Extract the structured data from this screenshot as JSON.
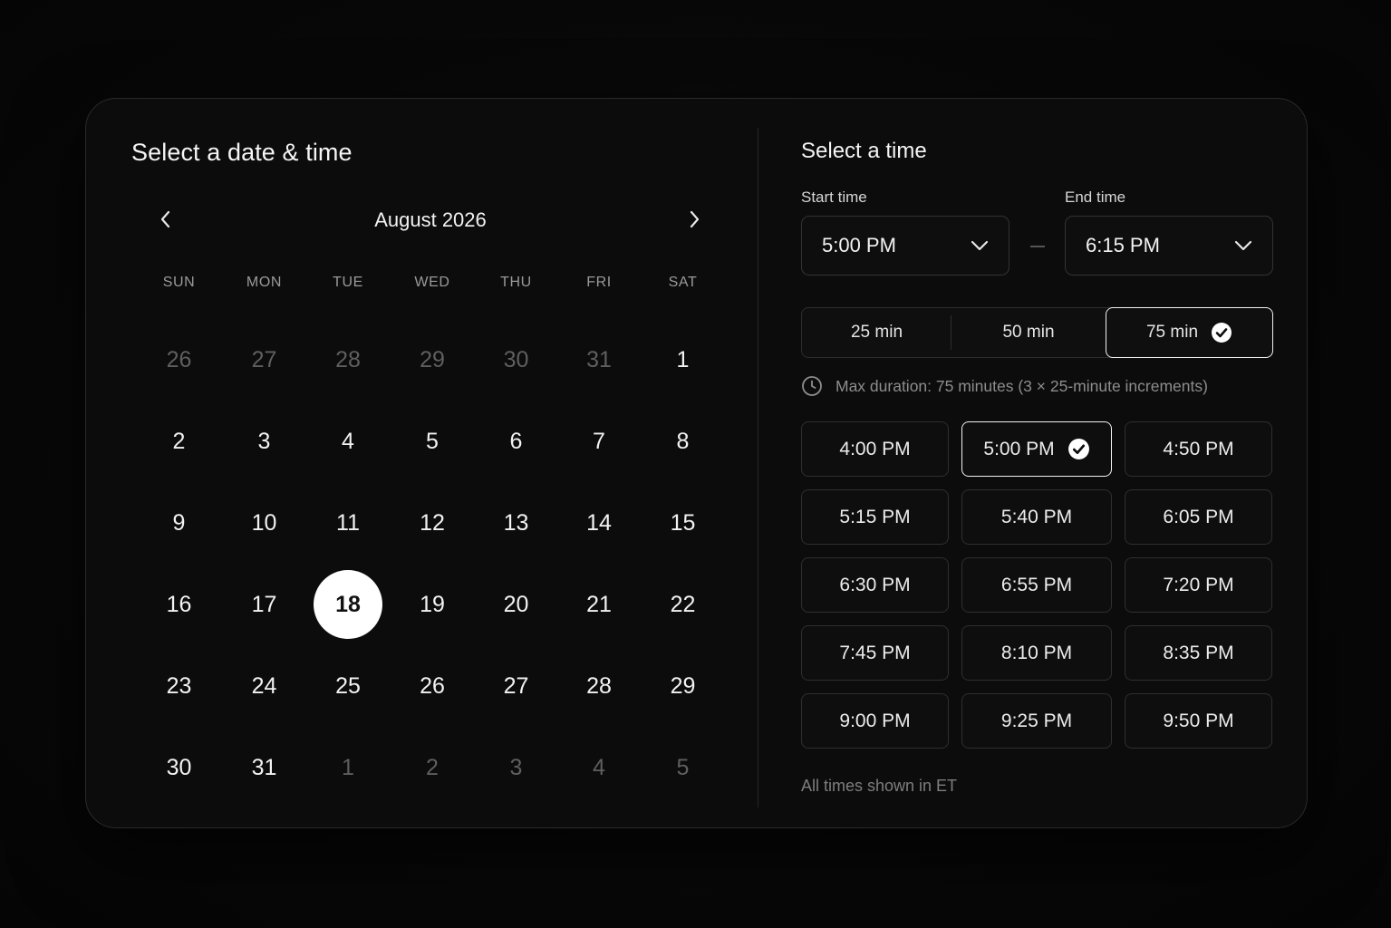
{
  "left": {
    "title": "Select a date & time",
    "month_label": "August 2026",
    "weekdays": [
      "SUN",
      "MON",
      "TUE",
      "WED",
      "THU",
      "FRI",
      "SAT"
    ],
    "days": [
      {
        "label": "26",
        "muted": true
      },
      {
        "label": "27",
        "muted": true
      },
      {
        "label": "28",
        "muted": true
      },
      {
        "label": "29",
        "muted": true
      },
      {
        "label": "30",
        "muted": true
      },
      {
        "label": "31",
        "muted": true
      },
      {
        "label": "1"
      },
      {
        "label": "2"
      },
      {
        "label": "3"
      },
      {
        "label": "4"
      },
      {
        "label": "5"
      },
      {
        "label": "6"
      },
      {
        "label": "7"
      },
      {
        "label": "8"
      },
      {
        "label": "9"
      },
      {
        "label": "10"
      },
      {
        "label": "11"
      },
      {
        "label": "12"
      },
      {
        "label": "13"
      },
      {
        "label": "14"
      },
      {
        "label": "15"
      },
      {
        "label": "16"
      },
      {
        "label": "17"
      },
      {
        "label": "18",
        "selected": true
      },
      {
        "label": "19"
      },
      {
        "label": "20"
      },
      {
        "label": "21"
      },
      {
        "label": "22"
      },
      {
        "label": "23"
      },
      {
        "label": "24"
      },
      {
        "label": "25"
      },
      {
        "label": "26"
      },
      {
        "label": "27"
      },
      {
        "label": "28"
      },
      {
        "label": "29"
      },
      {
        "label": "30"
      },
      {
        "label": "31"
      },
      {
        "label": "1",
        "muted": true
      },
      {
        "label": "2",
        "muted": true
      },
      {
        "label": "3",
        "muted": true
      },
      {
        "label": "4",
        "muted": true
      },
      {
        "label": "5",
        "muted": true
      }
    ]
  },
  "right": {
    "title": "Select a time",
    "start_label": "Start time",
    "start_value": "5:00 PM",
    "end_label": "End time",
    "end_value": "6:15 PM",
    "durations": [
      {
        "label": "25 min"
      },
      {
        "label": "50 min"
      },
      {
        "label": "75 min",
        "active": true
      }
    ],
    "note": "Max duration: 75 minutes (3 × 25-minute increments)",
    "slots": [
      {
        "label": "4:00 PM"
      },
      {
        "label": "5:00 PM",
        "active": true
      },
      {
        "label": "4:50 PM"
      },
      {
        "label": "5:15 PM"
      },
      {
        "label": "5:40 PM"
      },
      {
        "label": "6:05 PM"
      },
      {
        "label": "6:30 PM"
      },
      {
        "label": "6:55 PM"
      },
      {
        "label": "7:20 PM"
      },
      {
        "label": "7:45 PM"
      },
      {
        "label": "8:10 PM"
      },
      {
        "label": "8:35 PM"
      },
      {
        "label": "9:00 PM"
      },
      {
        "label": "9:25 PM"
      },
      {
        "label": "9:50 PM"
      }
    ],
    "footer": "All times shown in ET"
  },
  "colors": {
    "background": "#070707",
    "card": "#0c0c0c",
    "border": "#2f2f2f",
    "text": "#f2f2f2",
    "muted_text": "#5f5f5f",
    "selected_fill": "#ffffff"
  },
  "icons": {
    "prev": "chevron-left-icon",
    "next": "chevron-right-icon",
    "dropdown": "chevron-down-icon",
    "check": "check-circle-icon",
    "clock": "clock-icon"
  }
}
